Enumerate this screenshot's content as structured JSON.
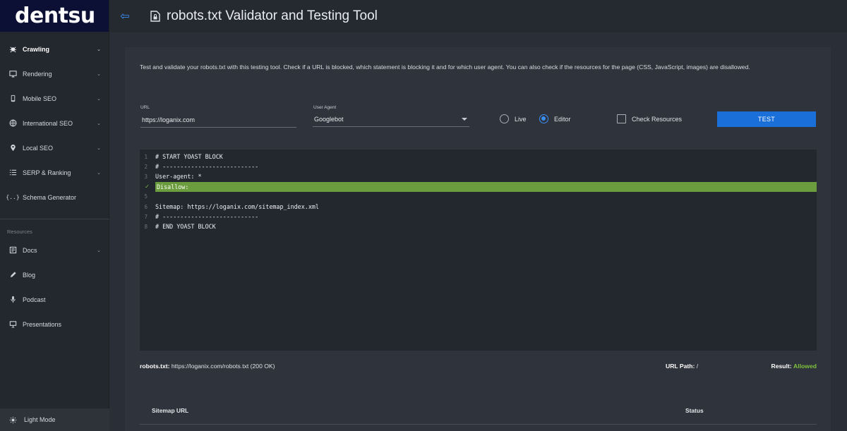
{
  "brand": {
    "logo_text": "dentsu"
  },
  "sidebar": {
    "items": [
      {
        "label": "Crawling",
        "icon": "bug-icon",
        "active": true,
        "has_chevron": true
      },
      {
        "label": "Rendering",
        "icon": "monitor-icon",
        "active": false,
        "has_chevron": true
      },
      {
        "label": "Mobile SEO",
        "icon": "mobile-icon",
        "active": false,
        "has_chevron": true
      },
      {
        "label": "International SEO",
        "icon": "globe-icon",
        "active": false,
        "has_chevron": true
      },
      {
        "label": "Local SEO",
        "icon": "map-pin-icon",
        "active": false,
        "has_chevron": true
      },
      {
        "label": "SERP & Ranking",
        "icon": "list-icon",
        "active": false,
        "has_chevron": true
      },
      {
        "label": "Schema Generator",
        "icon": "braces-icon",
        "active": false,
        "has_chevron": false
      }
    ],
    "section_label": "Resources",
    "resources": [
      {
        "label": "Docs",
        "icon": "document-icon",
        "has_chevron": true
      },
      {
        "label": "Blog",
        "icon": "pencil-icon",
        "has_chevron": false
      },
      {
        "label": "Podcast",
        "icon": "microphone-icon",
        "has_chevron": false
      },
      {
        "label": "Presentations",
        "icon": "presentation-icon",
        "has_chevron": false
      }
    ],
    "light_mode_label": "Light Mode"
  },
  "header": {
    "title": "robots.txt Validator and Testing Tool"
  },
  "main": {
    "description": "Test and validate your robots.txt with this testing tool. Check if a URL is blocked, which statement is blocking it and for which user agent. You can also check if the resources for the page (CSS, JavaScript, images) are disallowed.",
    "url_label": "URL",
    "url_value": "https://loganix.com",
    "user_agent_label": "User Agent",
    "user_agent_value": "Googlebot",
    "mode_options": [
      {
        "label": "Live",
        "selected": false
      },
      {
        "label": "Editor",
        "selected": true
      }
    ],
    "check_resources_label": "Check Resources",
    "check_resources_checked": false,
    "test_button": "TEST"
  },
  "editor": {
    "lines": [
      {
        "no": "1",
        "text": "# START YOAST BLOCK",
        "highlight": false
      },
      {
        "no": "2",
        "text": "# ---------------------------",
        "highlight": false
      },
      {
        "no": "3",
        "text": "User-agent: *",
        "highlight": false
      },
      {
        "no": "✓",
        "text": "Disallow:",
        "highlight": true
      },
      {
        "no": "5",
        "text": "",
        "highlight": false
      },
      {
        "no": "6",
        "text": "Sitemap: https://loganix.com/sitemap_index.xml",
        "highlight": false
      },
      {
        "no": "7",
        "text": "# ---------------------------",
        "highlight": false
      },
      {
        "no": "8",
        "text": "# END YOAST BLOCK",
        "highlight": false
      }
    ]
  },
  "result": {
    "robots_label": "robots.txt:",
    "robots_value": "https://loganix.com/robots.txt (200 OK)",
    "path_label": "URL Path:",
    "path_value": "/",
    "result_label": "Result:",
    "result_value": "Allowed"
  },
  "table": {
    "headers": [
      "Sitemap URL",
      "Status"
    ]
  },
  "colors": {
    "accent": "#1a6fd8",
    "highlight": "#6b9c3d",
    "allowed": "#7ec13d",
    "logo_bg": "#0b1034"
  }
}
